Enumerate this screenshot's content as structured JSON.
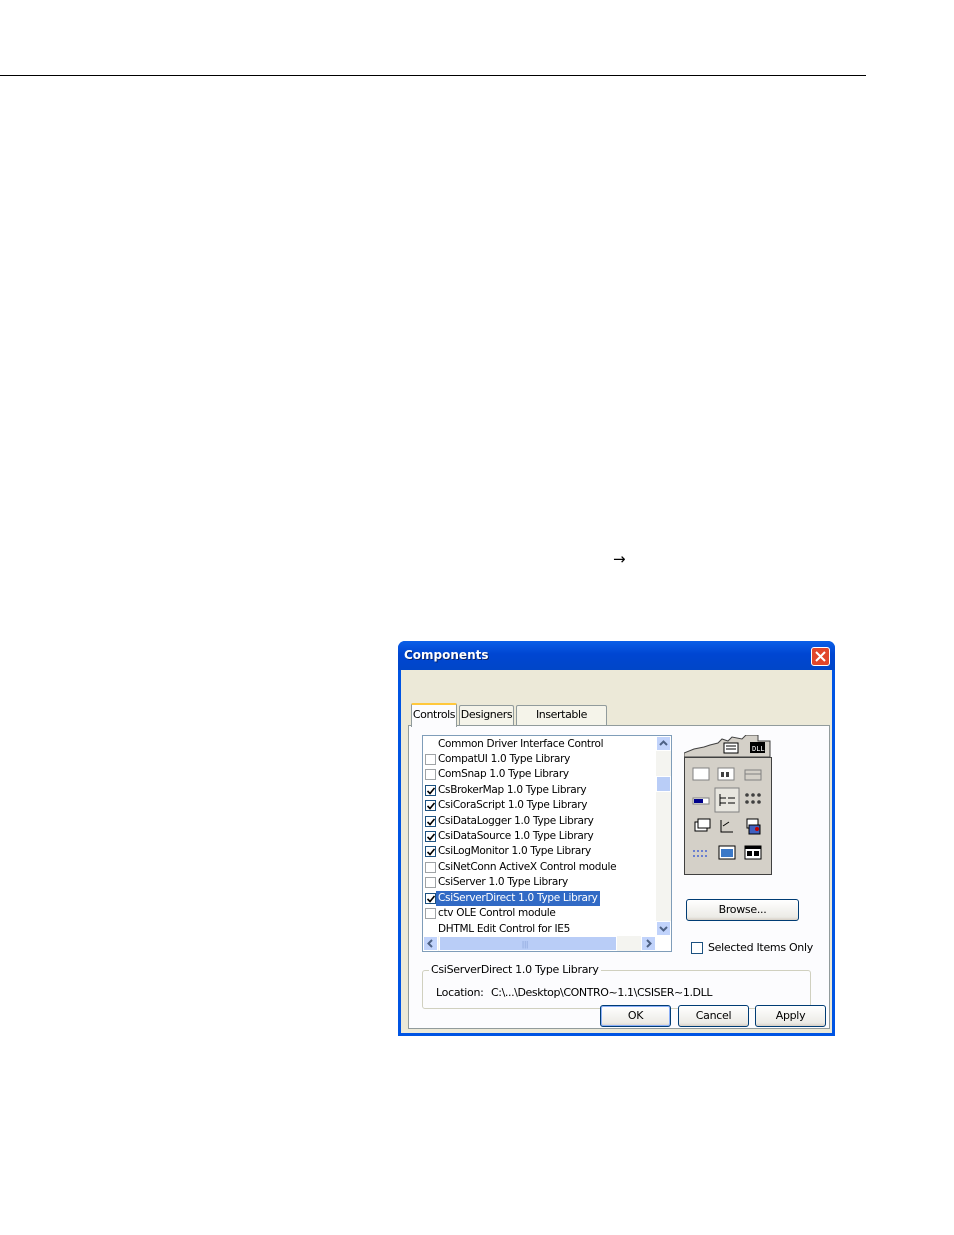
{
  "page": {
    "arrow_glyph": "→"
  },
  "dialog": {
    "title": "Components",
    "tabs": [
      {
        "label": "Controls",
        "active": true
      },
      {
        "label": "Designers",
        "active": false
      },
      {
        "label": "Insertable Objects",
        "active": false
      }
    ],
    "list_items": [
      {
        "label": "Common Driver Interface Control",
        "checked": false,
        "checkbox_visible": false,
        "selected": false
      },
      {
        "label": "CompatUI 1.0 Type Library",
        "checked": false,
        "checkbox_visible": true,
        "selected": false
      },
      {
        "label": "ComSnap 1.0 Type Library",
        "checked": false,
        "checkbox_visible": true,
        "selected": false
      },
      {
        "label": "CsBrokerMap 1.0 Type Library",
        "checked": true,
        "checkbox_visible": true,
        "selected": false
      },
      {
        "label": "CsiCoraScript 1.0 Type Library",
        "checked": true,
        "checkbox_visible": true,
        "selected": false
      },
      {
        "label": "CsiDataLogger 1.0 Type Library",
        "checked": true,
        "checkbox_visible": true,
        "selected": false
      },
      {
        "label": "CsiDataSource 1.0 Type Library",
        "checked": true,
        "checkbox_visible": true,
        "selected": false
      },
      {
        "label": "CsiLogMonitor 1.0 Type Library",
        "checked": true,
        "checkbox_visible": true,
        "selected": false
      },
      {
        "label": "CsiNetConn ActiveX Control module",
        "checked": false,
        "checkbox_visible": true,
        "selected": false
      },
      {
        "label": "CsiServer 1.0 Type Library",
        "checked": false,
        "checkbox_visible": true,
        "selected": false
      },
      {
        "label": "CsiServerDirect 1.0 Type Library",
        "checked": true,
        "checkbox_visible": true,
        "selected": true
      },
      {
        "label": "ctv OLE Control module",
        "checked": false,
        "checkbox_visible": true,
        "selected": false
      },
      {
        "label": "DHTML Edit Control for IE5",
        "checked": false,
        "checkbox_visible": false,
        "selected": false
      }
    ],
    "browse_label": "Browse...",
    "selected_only_label": "Selected Items Only",
    "selected_only_checked": false,
    "group_title": "CsiServerDirect 1.0 Type Library",
    "location_label": "Location:",
    "location_value": "C:\\...\\Desktop\\CONTRO~1.1\\CSISER~1.DLL",
    "ok_label": "OK",
    "cancel_label": "Cancel",
    "apply_label": "Apply"
  },
  "icons": {
    "close": "close-icon",
    "check": "checkmark-icon",
    "scroll_up": "arrow-up-icon",
    "scroll_down": "arrow-down-icon",
    "scroll_left": "arrow-left-icon",
    "scroll_right": "arrow-right-icon",
    "toolbox": "toolbox-controls-icon"
  },
  "colors": {
    "titlebar": "#0054e3",
    "selection": "#316ac5",
    "dialog_face": "#ece9d8",
    "close_button": "#e1462b"
  }
}
